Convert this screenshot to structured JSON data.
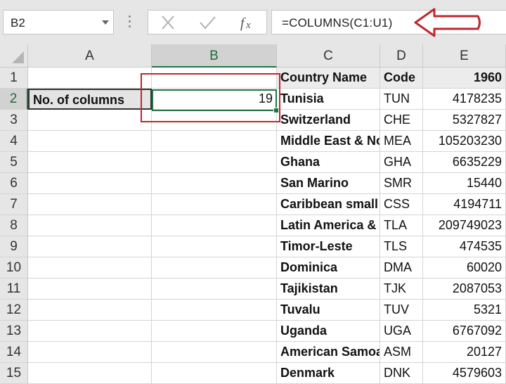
{
  "formula_bar": {
    "name_box": "B2",
    "formula": "=COLUMNS(C1:U1)"
  },
  "columns": [
    "A",
    "B",
    "C",
    "D",
    "E"
  ],
  "row_numbers": [
    "1",
    "2",
    "3",
    "4",
    "5",
    "6",
    "7",
    "8",
    "9",
    "10",
    "11",
    "12",
    "13",
    "14",
    "15"
  ],
  "cells": {
    "A2": "No. of columns",
    "B2": "19",
    "C1": "Country Name",
    "D1": "Code",
    "E1": "1960"
  },
  "rows": [
    {
      "c": "Tunisia",
      "d": "TUN",
      "e": "4178235"
    },
    {
      "c": "Switzerland",
      "d": "CHE",
      "e": "5327827"
    },
    {
      "c": "Middle East & North Africa",
      "d": "MEA",
      "e": "105203230"
    },
    {
      "c": "Ghana",
      "d": "GHA",
      "e": "6635229"
    },
    {
      "c": "San Marino",
      "d": "SMR",
      "e": "15440"
    },
    {
      "c": "Caribbean small states",
      "d": "CSS",
      "e": "4194711"
    },
    {
      "c": "Latin America & Caribbean",
      "d": "TLA",
      "e": "209749023"
    },
    {
      "c": "Timor-Leste",
      "d": "TLS",
      "e": "474535"
    },
    {
      "c": "Dominica",
      "d": "DMA",
      "e": "60020"
    },
    {
      "c": "Tajikistan",
      "d": "TJK",
      "e": "2087053"
    },
    {
      "c": "Tuvalu",
      "d": "TUV",
      "e": "5321"
    },
    {
      "c": "Uganda",
      "d": "UGA",
      "e": "6767092"
    },
    {
      "c": "American Samoa",
      "d": "ASM",
      "e": "20127"
    },
    {
      "c": "Denmark",
      "d": "DNK",
      "e": "4579603"
    }
  ],
  "icons": {
    "cancel": "close-icon",
    "enter": "checkmark-icon",
    "function": "fx-icon",
    "annotation": "red-arrow"
  },
  "colors": {
    "selection": "#217346",
    "annotation": "#c0262d"
  }
}
